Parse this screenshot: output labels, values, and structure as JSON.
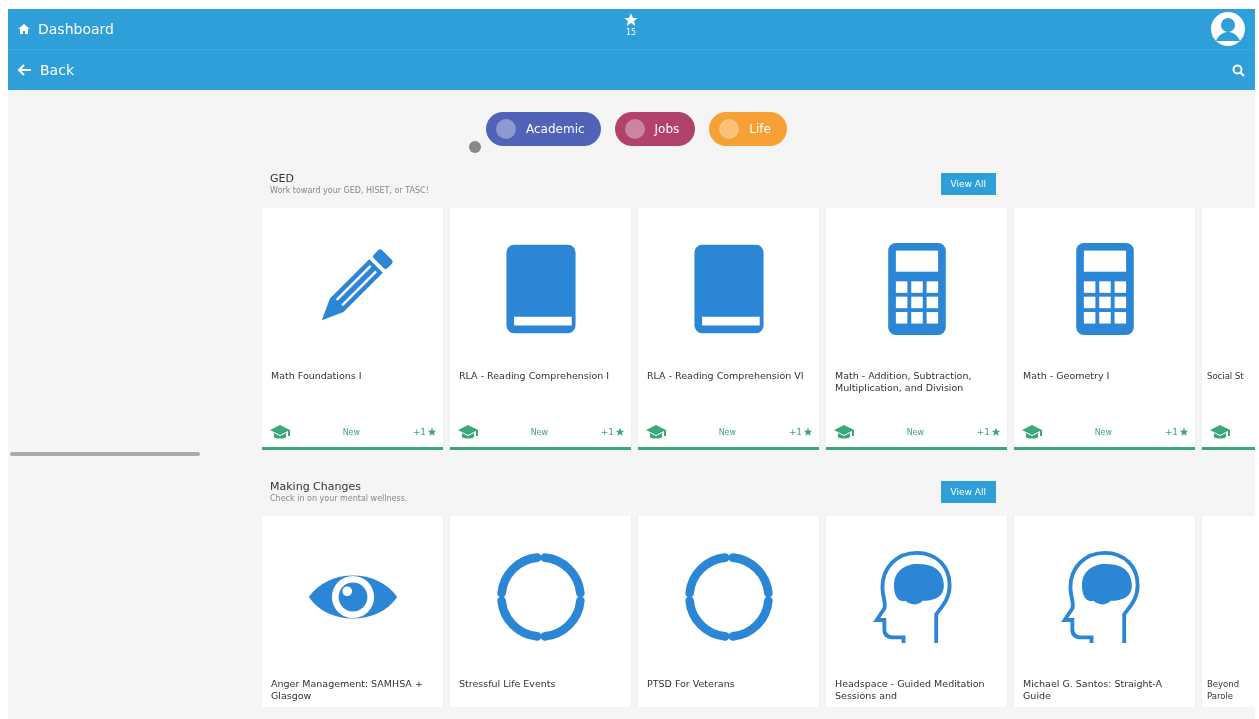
{
  "top_bar": {
    "dashboard": "Dashboard",
    "star_count": "15",
    "back": "Back"
  },
  "categories": [
    {
      "label": "Academic",
      "color": "#5163b8"
    },
    {
      "label": "Jobs",
      "color": "#b2426c"
    },
    {
      "label": "Life",
      "color": "#f7a035"
    }
  ],
  "sections": [
    {
      "title": "GED",
      "subtitle": "Work toward your GED, HISET, or TASC!",
      "button": "View All",
      "cards": [
        {
          "title": "Math Foundations I",
          "kind": "pencil",
          "footer": true,
          "status": "New",
          "reward": "+1"
        },
        {
          "title": "RLA - Reading Comprehension I",
          "kind": "book",
          "footer": true,
          "status": "New",
          "reward": "+1"
        },
        {
          "title": "RLA - Reading Comprehension VI",
          "kind": "book",
          "footer": true,
          "status": "New",
          "reward": "+1"
        },
        {
          "title": "Math - Addition, Subtraction, Multiplication, and Division",
          "kind": "calculator",
          "footer": true,
          "status": "New",
          "reward": "+1"
        },
        {
          "title": "Math - Geometry I",
          "kind": "calculator",
          "footer": true,
          "status": "New",
          "reward": "+1"
        },
        {
          "title": "Social St",
          "footer": true
        }
      ]
    },
    {
      "title": "Making Changes",
      "subtitle": "Check in on your mental wellness.",
      "button": "View All",
      "cards": [
        {
          "title": "Anger Management: SAMHSA + Glasgow",
          "kind": "eye",
          "footer": false
        },
        {
          "title": "Stressful Life Events",
          "kind": "cycle",
          "footer": false
        },
        {
          "title": "PTSD For Veterans",
          "kind": "cycle",
          "footer": false
        },
        {
          "title": "Headspace - Guided Meditation Sessions and",
          "kind": "head",
          "footer": false
        },
        {
          "title": "Michael G. Santos: Straight-A Guide",
          "kind": "head",
          "footer": false
        },
        {
          "title": "Beyond Parole",
          "footer": false
        }
      ]
    }
  ]
}
